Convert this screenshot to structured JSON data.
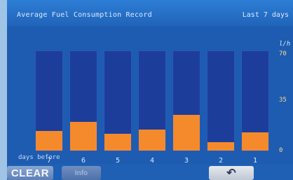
{
  "header": {
    "title": "Average Fuel Consumption Record",
    "period": "Last 7 days"
  },
  "chart_data": {
    "type": "bar",
    "unit": "l/h",
    "ylim": [
      0,
      70
    ],
    "yticks": [
      "70",
      "35",
      "0"
    ],
    "categories": [
      "7",
      "6",
      "5",
      "4",
      "3",
      "2",
      "1"
    ],
    "values": [
      14,
      20,
      12,
      15,
      25,
      6,
      13
    ],
    "xlabel": "days before",
    "bar_color": "#f58a2d",
    "track_color": "#1c3e9a"
  },
  "footer": {
    "clear_label": "CLEAR",
    "info_label": "Info",
    "back_icon": "back-arrow-icon"
  }
}
